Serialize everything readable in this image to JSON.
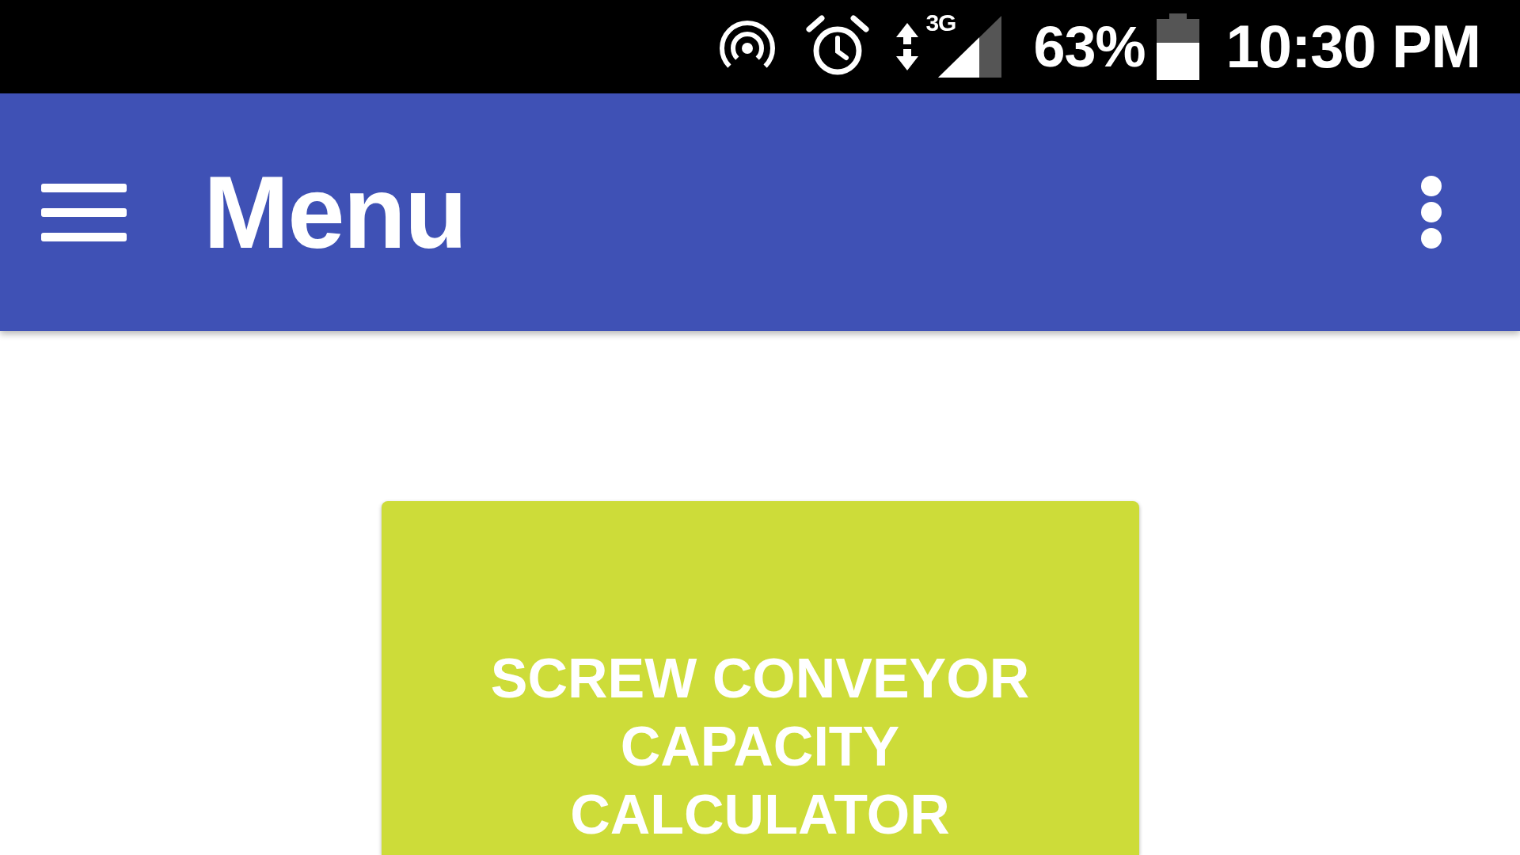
{
  "status_bar": {
    "network_type": "3G",
    "battery_percent": "63%",
    "time": "10:30 PM"
  },
  "app_bar": {
    "title": "Menu"
  },
  "menu_buttons": [
    {
      "label": "SCREW CONVEYOR CAPACITY CALCULATOR"
    }
  ]
}
